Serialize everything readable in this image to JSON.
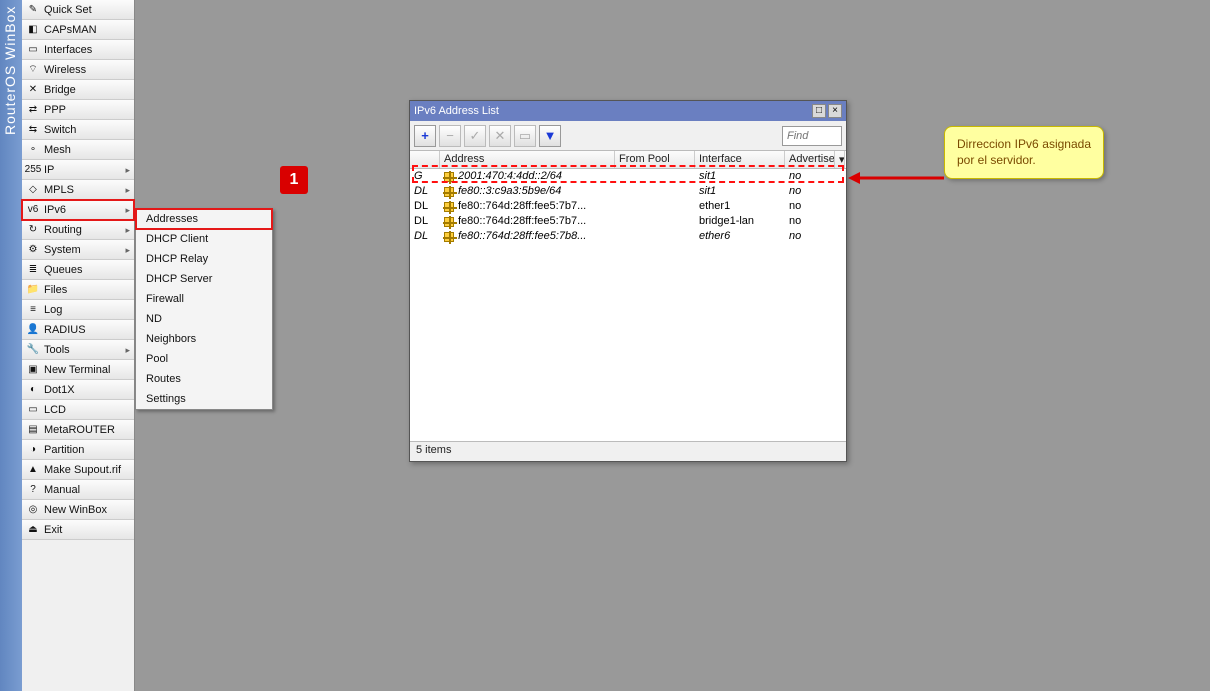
{
  "app_title": "RouterOS WinBox",
  "sidebar": {
    "items": [
      {
        "label": "Quick Set",
        "icon": "✎",
        "sub": false
      },
      {
        "label": "CAPsMAN",
        "icon": "◧",
        "sub": false
      },
      {
        "label": "Interfaces",
        "icon": "▭",
        "sub": false
      },
      {
        "label": "Wireless",
        "icon": "⌔",
        "sub": false
      },
      {
        "label": "Bridge",
        "icon": "✕",
        "sub": false
      },
      {
        "label": "PPP",
        "icon": "⇄",
        "sub": false
      },
      {
        "label": "Switch",
        "icon": "⇆",
        "sub": false
      },
      {
        "label": "Mesh",
        "icon": "∘",
        "sub": false
      },
      {
        "label": "IP",
        "icon": "255",
        "sub": true
      },
      {
        "label": "MPLS",
        "icon": "◇",
        "sub": true
      },
      {
        "label": "IPv6",
        "icon": "v6",
        "sub": true,
        "highlight": true
      },
      {
        "label": "Routing",
        "icon": "↻",
        "sub": true
      },
      {
        "label": "System",
        "icon": "⚙",
        "sub": true
      },
      {
        "label": "Queues",
        "icon": "≣",
        "sub": false
      },
      {
        "label": "Files",
        "icon": "📁",
        "sub": false
      },
      {
        "label": "Log",
        "icon": "≡",
        "sub": false
      },
      {
        "label": "RADIUS",
        "icon": "👤",
        "sub": false
      },
      {
        "label": "Tools",
        "icon": "🔧",
        "sub": true
      },
      {
        "label": "New Terminal",
        "icon": "▣",
        "sub": false
      },
      {
        "label": "Dot1X",
        "icon": "◐",
        "sub": false
      },
      {
        "label": "LCD",
        "icon": "▭",
        "sub": false
      },
      {
        "label": "MetaROUTER",
        "icon": "▤",
        "sub": false
      },
      {
        "label": "Partition",
        "icon": "◑",
        "sub": false
      },
      {
        "label": "Make Supout.rif",
        "icon": "▲",
        "sub": false
      },
      {
        "label": "Manual",
        "icon": "?",
        "sub": false
      },
      {
        "label": "New WinBox",
        "icon": "◎",
        "sub": false
      },
      {
        "label": "Exit",
        "icon": "⏏",
        "sub": false
      }
    ]
  },
  "submenu": {
    "items": [
      {
        "label": "Addresses",
        "highlight": true
      },
      {
        "label": "DHCP Client"
      },
      {
        "label": "DHCP Relay"
      },
      {
        "label": "DHCP Server"
      },
      {
        "label": "Firewall"
      },
      {
        "label": "ND"
      },
      {
        "label": "Neighbors"
      },
      {
        "label": "Pool"
      },
      {
        "label": "Routes"
      },
      {
        "label": "Settings"
      }
    ]
  },
  "callout": {
    "num": "1"
  },
  "window": {
    "title": "IPv6 Address List",
    "find_placeholder": "Find",
    "columns": {
      "flags": "",
      "address": "Address",
      "from_pool": "From Pool",
      "interface": "Interface",
      "advertise": "Advertise"
    },
    "rows": [
      {
        "flags": "G",
        "address": "2001:470:4:4dd::2/64",
        "from_pool": "",
        "interface": "sit1",
        "advertise": "no",
        "em": true
      },
      {
        "flags": "DL",
        "address": "fe80::3:c9a3:5b9e/64",
        "from_pool": "",
        "interface": "sit1",
        "advertise": "no",
        "em": true
      },
      {
        "flags": "DL",
        "address": "fe80::764d:28ff:fee5:7b7...",
        "from_pool": "",
        "interface": "ether1",
        "advertise": "no"
      },
      {
        "flags": "DL",
        "address": "fe80::764d:28ff:fee5:7b7...",
        "from_pool": "",
        "interface": "bridge1-lan",
        "advertise": "no"
      },
      {
        "flags": "DL",
        "address": "fe80::764d:28ff:fee5:7b8...",
        "from_pool": "",
        "interface": "ether6",
        "advertise": "no",
        "em": true
      }
    ],
    "status": "5 items"
  },
  "annotation": "Dirreccion IPv6 asignada por el servidor."
}
